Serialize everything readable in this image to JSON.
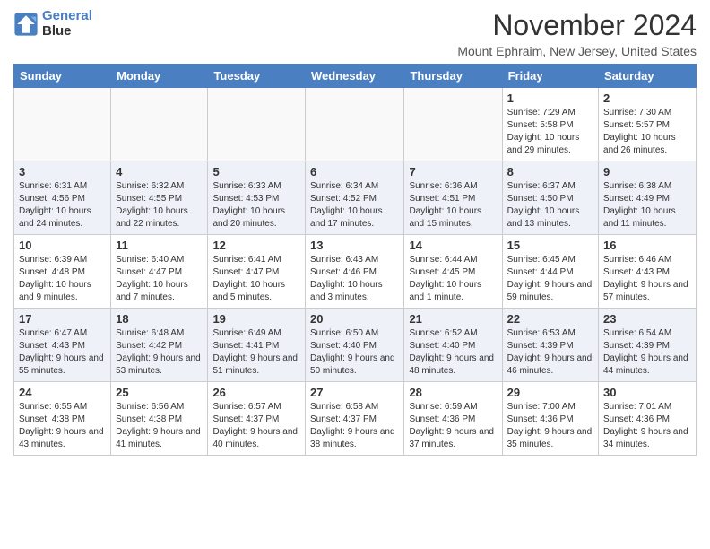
{
  "header": {
    "logo_line1": "General",
    "logo_line2": "Blue",
    "main_title": "November 2024",
    "subtitle": "Mount Ephraim, New Jersey, United States"
  },
  "calendar": {
    "days_of_week": [
      "Sunday",
      "Monday",
      "Tuesday",
      "Wednesday",
      "Thursday",
      "Friday",
      "Saturday"
    ],
    "weeks": [
      [
        {
          "day": "",
          "info": ""
        },
        {
          "day": "",
          "info": ""
        },
        {
          "day": "",
          "info": ""
        },
        {
          "day": "",
          "info": ""
        },
        {
          "day": "",
          "info": ""
        },
        {
          "day": "1",
          "info": "Sunrise: 7:29 AM\nSunset: 5:58 PM\nDaylight: 10 hours and 29 minutes."
        },
        {
          "day": "2",
          "info": "Sunrise: 7:30 AM\nSunset: 5:57 PM\nDaylight: 10 hours and 26 minutes."
        }
      ],
      [
        {
          "day": "3",
          "info": "Sunrise: 6:31 AM\nSunset: 4:56 PM\nDaylight: 10 hours and 24 minutes."
        },
        {
          "day": "4",
          "info": "Sunrise: 6:32 AM\nSunset: 4:55 PM\nDaylight: 10 hours and 22 minutes."
        },
        {
          "day": "5",
          "info": "Sunrise: 6:33 AM\nSunset: 4:53 PM\nDaylight: 10 hours and 20 minutes."
        },
        {
          "day": "6",
          "info": "Sunrise: 6:34 AM\nSunset: 4:52 PM\nDaylight: 10 hours and 17 minutes."
        },
        {
          "day": "7",
          "info": "Sunrise: 6:36 AM\nSunset: 4:51 PM\nDaylight: 10 hours and 15 minutes."
        },
        {
          "day": "8",
          "info": "Sunrise: 6:37 AM\nSunset: 4:50 PM\nDaylight: 10 hours and 13 minutes."
        },
        {
          "day": "9",
          "info": "Sunrise: 6:38 AM\nSunset: 4:49 PM\nDaylight: 10 hours and 11 minutes."
        }
      ],
      [
        {
          "day": "10",
          "info": "Sunrise: 6:39 AM\nSunset: 4:48 PM\nDaylight: 10 hours and 9 minutes."
        },
        {
          "day": "11",
          "info": "Sunrise: 6:40 AM\nSunset: 4:47 PM\nDaylight: 10 hours and 7 minutes."
        },
        {
          "day": "12",
          "info": "Sunrise: 6:41 AM\nSunset: 4:47 PM\nDaylight: 10 hours and 5 minutes."
        },
        {
          "day": "13",
          "info": "Sunrise: 6:43 AM\nSunset: 4:46 PM\nDaylight: 10 hours and 3 minutes."
        },
        {
          "day": "14",
          "info": "Sunrise: 6:44 AM\nSunset: 4:45 PM\nDaylight: 10 hours and 1 minute."
        },
        {
          "day": "15",
          "info": "Sunrise: 6:45 AM\nSunset: 4:44 PM\nDaylight: 9 hours and 59 minutes."
        },
        {
          "day": "16",
          "info": "Sunrise: 6:46 AM\nSunset: 4:43 PM\nDaylight: 9 hours and 57 minutes."
        }
      ],
      [
        {
          "day": "17",
          "info": "Sunrise: 6:47 AM\nSunset: 4:43 PM\nDaylight: 9 hours and 55 minutes."
        },
        {
          "day": "18",
          "info": "Sunrise: 6:48 AM\nSunset: 4:42 PM\nDaylight: 9 hours and 53 minutes."
        },
        {
          "day": "19",
          "info": "Sunrise: 6:49 AM\nSunset: 4:41 PM\nDaylight: 9 hours and 51 minutes."
        },
        {
          "day": "20",
          "info": "Sunrise: 6:50 AM\nSunset: 4:40 PM\nDaylight: 9 hours and 50 minutes."
        },
        {
          "day": "21",
          "info": "Sunrise: 6:52 AM\nSunset: 4:40 PM\nDaylight: 9 hours and 48 minutes."
        },
        {
          "day": "22",
          "info": "Sunrise: 6:53 AM\nSunset: 4:39 PM\nDaylight: 9 hours and 46 minutes."
        },
        {
          "day": "23",
          "info": "Sunrise: 6:54 AM\nSunset: 4:39 PM\nDaylight: 9 hours and 44 minutes."
        }
      ],
      [
        {
          "day": "24",
          "info": "Sunrise: 6:55 AM\nSunset: 4:38 PM\nDaylight: 9 hours and 43 minutes."
        },
        {
          "day": "25",
          "info": "Sunrise: 6:56 AM\nSunset: 4:38 PM\nDaylight: 9 hours and 41 minutes."
        },
        {
          "day": "26",
          "info": "Sunrise: 6:57 AM\nSunset: 4:37 PM\nDaylight: 9 hours and 40 minutes."
        },
        {
          "day": "27",
          "info": "Sunrise: 6:58 AM\nSunset: 4:37 PM\nDaylight: 9 hours and 38 minutes."
        },
        {
          "day": "28",
          "info": "Sunrise: 6:59 AM\nSunset: 4:36 PM\nDaylight: 9 hours and 37 minutes."
        },
        {
          "day": "29",
          "info": "Sunrise: 7:00 AM\nSunset: 4:36 PM\nDaylight: 9 hours and 35 minutes."
        },
        {
          "day": "30",
          "info": "Sunrise: 7:01 AM\nSunset: 4:36 PM\nDaylight: 9 hours and 34 minutes."
        }
      ]
    ]
  }
}
